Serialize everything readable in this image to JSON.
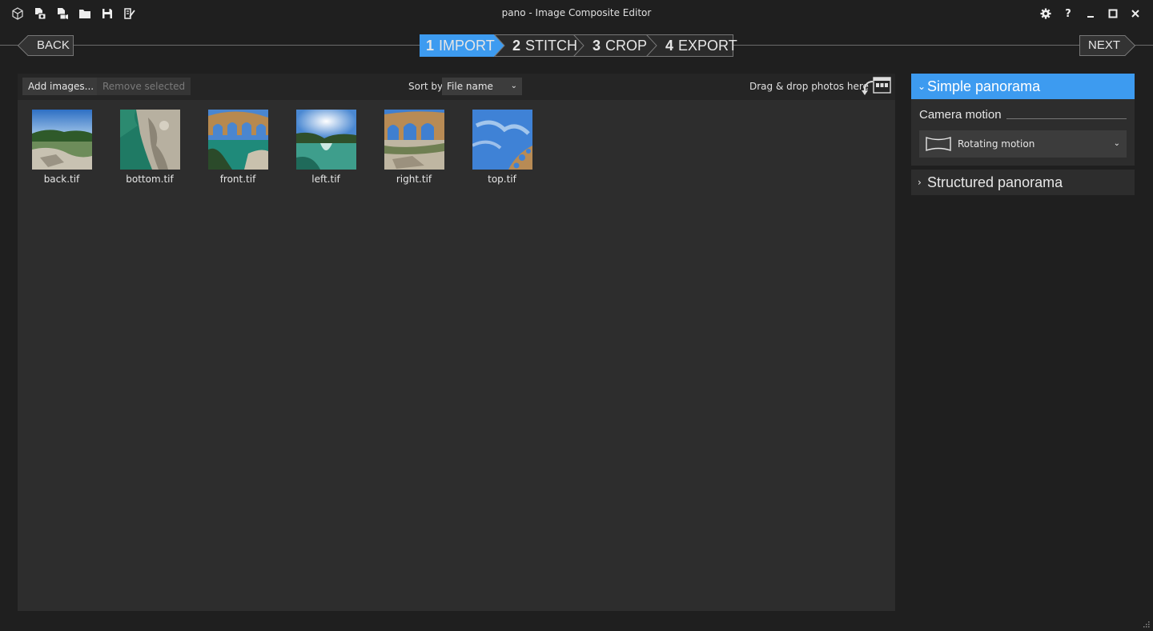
{
  "window": {
    "title": "pano - Image Composite Editor",
    "settings_icon": "gear-icon",
    "help_label": "?",
    "minimize_icon": "minimize-icon",
    "maximize_icon": "maximize-icon",
    "close_icon": "close-icon"
  },
  "quick_toolbar": [
    "cube-icon",
    "new-panorama-from-images-icon",
    "new-panorama-from-video-icon",
    "open-folder-icon",
    "save-icon",
    "publish-icon"
  ],
  "nav": {
    "back_label": "BACK",
    "next_label": "NEXT",
    "steps": [
      {
        "num": "1",
        "label": "IMPORT",
        "active": true
      },
      {
        "num": "2",
        "label": "STITCH",
        "active": false
      },
      {
        "num": "3",
        "label": "CROP",
        "active": false
      },
      {
        "num": "4",
        "label": "EXPORT",
        "active": false
      }
    ]
  },
  "import_toolbar": {
    "add_label": "Add images...",
    "remove_label": "Remove selected",
    "sort_label": "Sort by",
    "sort_value": "File name",
    "drag_hint": "Drag & drop photos here"
  },
  "images": [
    {
      "name": "back.tif"
    },
    {
      "name": "bottom.tif"
    },
    {
      "name": "front.tif"
    },
    {
      "name": "left.tif"
    },
    {
      "name": "right.tif"
    },
    {
      "name": "top.tif"
    }
  ],
  "side_panel": {
    "simple_title": "Simple panorama",
    "camera_motion_label": "Camera motion",
    "camera_motion_value": "Rotating motion",
    "structured_title": "Structured panorama"
  },
  "colors": {
    "accent": "#3d9bf0",
    "background": "#1f1f1f",
    "panel": "#2d2d2d"
  }
}
